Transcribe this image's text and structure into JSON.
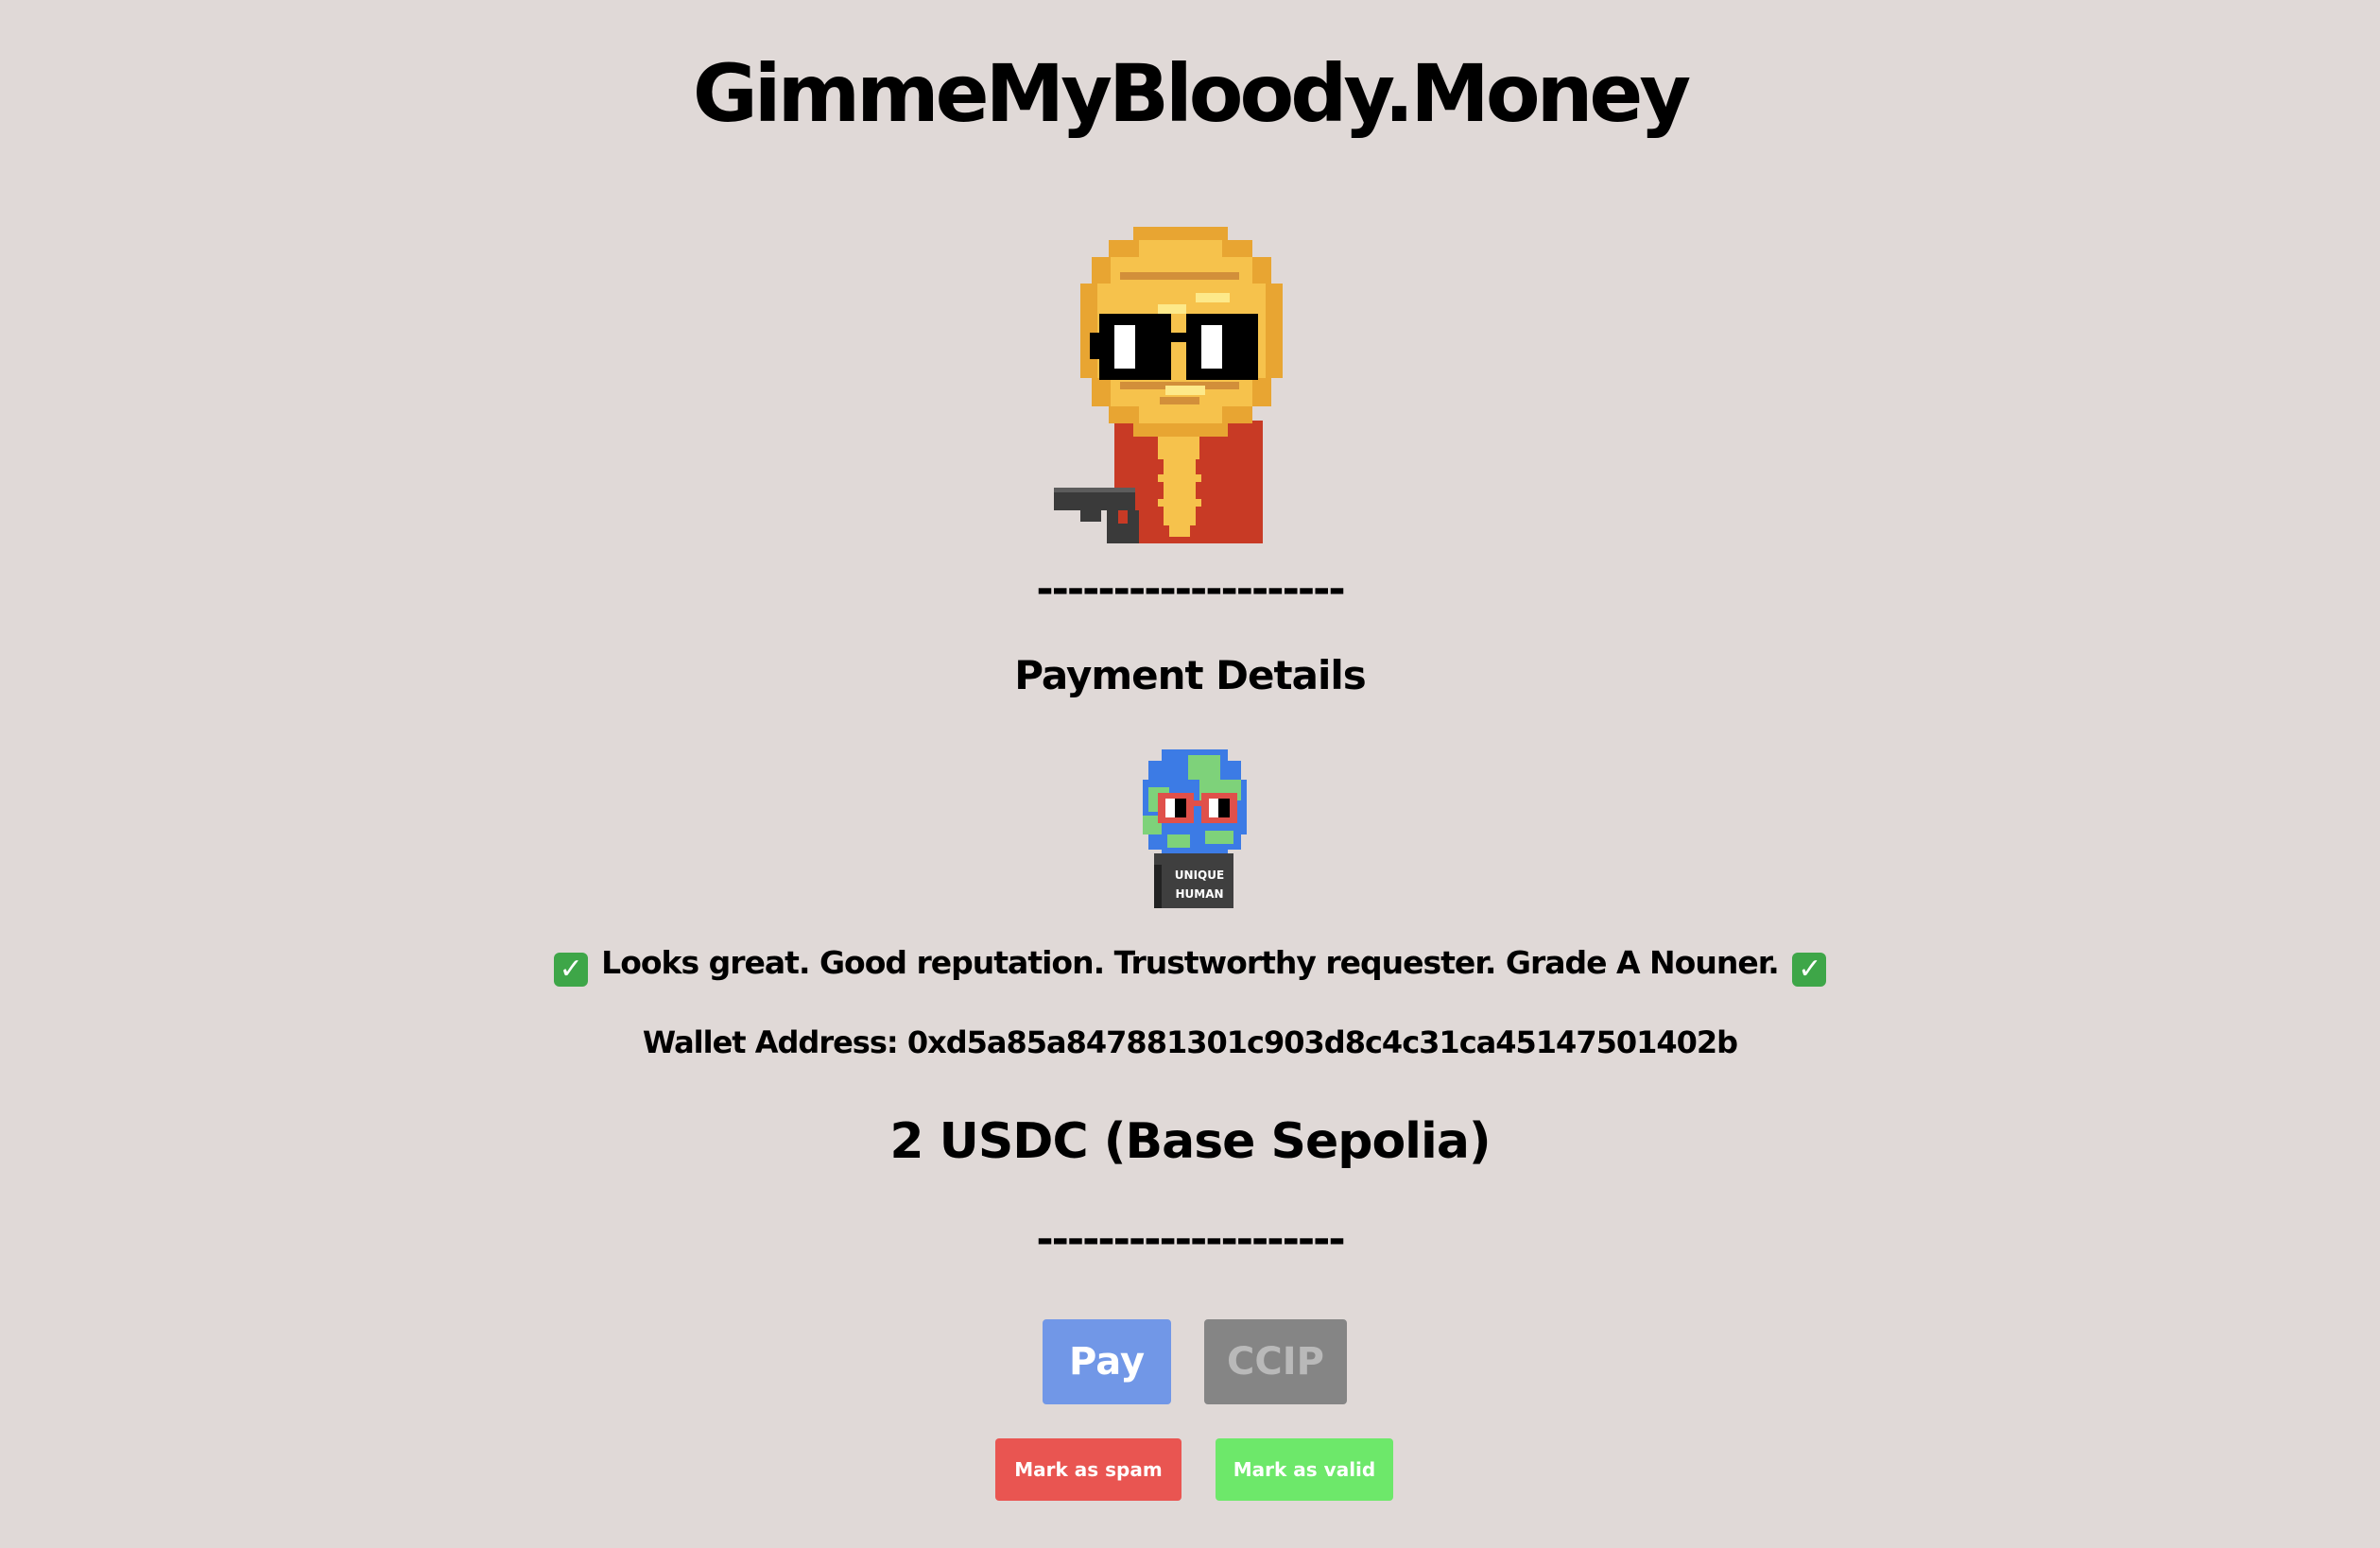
{
  "header": {
    "site_title": "GimmeMyBloody.Money"
  },
  "illustrations": {
    "mascot_icon": "coin-with-sunglasses-and-pistol",
    "badge_icon": "globe-with-glasses",
    "badge_text_line1": "UNIQUE",
    "badge_text_line2": "HUMAN"
  },
  "divider_text": "--------------------",
  "payment": {
    "section_title": "Payment Details",
    "reputation_check_icon": "✓",
    "reputation_text": "Looks great. Good reputation. Trustworthy requester. Grade A Nouner.",
    "wallet_line": "Wallet Address: 0xd5a85a847881301c903d8c4c31ca45147501402b",
    "amount_line": "2 USDC  (Base Sepolia)"
  },
  "actions": {
    "pay_label": "Pay",
    "ccip_label": "CCIP",
    "spam_label": "Mark as spam",
    "valid_label": "Mark as valid"
  },
  "colors": {
    "background": "#e0d9d7",
    "pay_button": "#7197e7",
    "ccip_button": "#858585",
    "spam_button": "#e95551",
    "valid_button": "#6de86a"
  }
}
